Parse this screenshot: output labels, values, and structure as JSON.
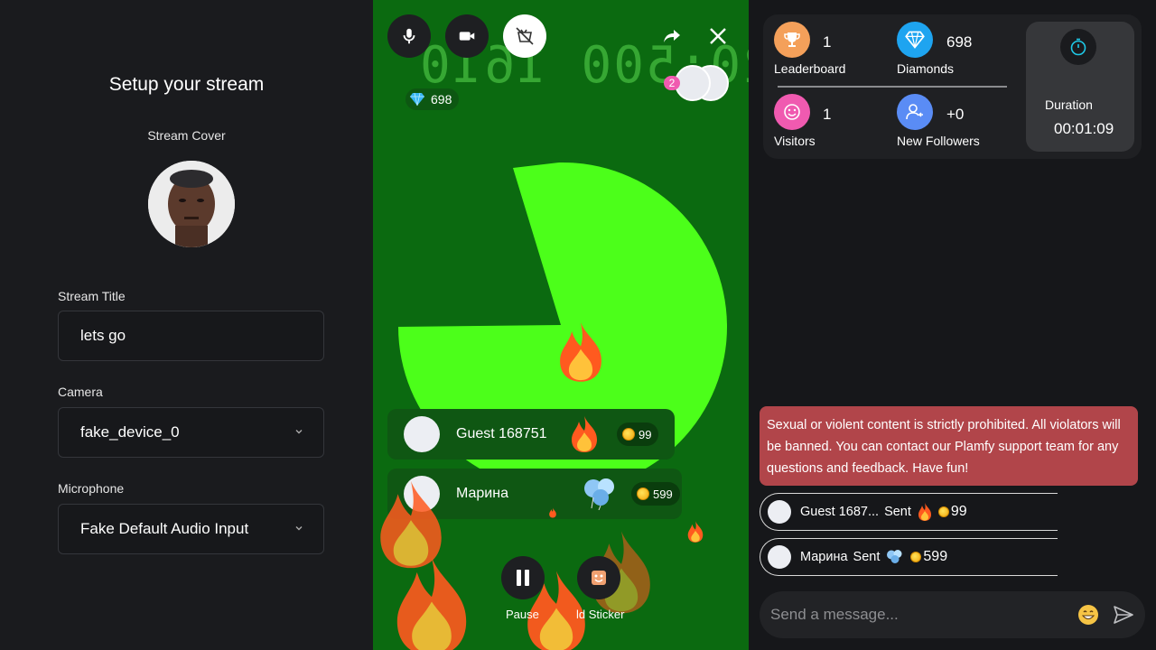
{
  "setup": {
    "title": "Setup your stream",
    "cover_label": "Stream Cover",
    "title_label": "Stream Title",
    "title_value": "lets go",
    "camera_label": "Camera",
    "camera_value": "fake_device_0",
    "mic_label": "Microphone",
    "mic_value": "Fake Default Audio Input"
  },
  "stream": {
    "diamonds": "698",
    "viewer_badge": "2",
    "background_text": "20:500 1610",
    "gifts": [
      {
        "name": "Guest 168751",
        "amount": "99",
        "gift_icon": "fire-icon"
      },
      {
        "name": "Марина",
        "amount": "599",
        "gift_icon": "balloons-icon"
      }
    ],
    "pause_label": "Pause",
    "sticker_label": "ld Sticker"
  },
  "stats": {
    "leaderboard_value": "1",
    "leaderboard_label": "Leaderboard",
    "diamonds_value": "698",
    "diamonds_label": "Diamonds",
    "visitors_value": "1",
    "visitors_label": "Visitors",
    "followers_value": "+0",
    "followers_label": "New Followers",
    "duration_label": "Duration",
    "duration_value": "00:01:09"
  },
  "chat": {
    "notice": "Sexual or violent content is strictly prohibited. All violators will be banned. You can contact our Plamfy support team for any questions and feedback. Have fun!",
    "rows": [
      {
        "name": "Guest 1687...",
        "verb": "Sent",
        "amount": "99"
      },
      {
        "name": "Марина",
        "verb": "Sent",
        "amount": "599"
      }
    ],
    "input_placeholder": "Send a message..."
  },
  "colors": {
    "stream_bg": "#0b6a10",
    "pacman": "#4cff1a",
    "notice_bg": "#b1454a",
    "leaderboard": "#f4a05a",
    "diamonds": "#1ea4f0",
    "visitors": "#f05ab0",
    "followers": "#5a8cf5",
    "timer": "#1ec8e6"
  }
}
